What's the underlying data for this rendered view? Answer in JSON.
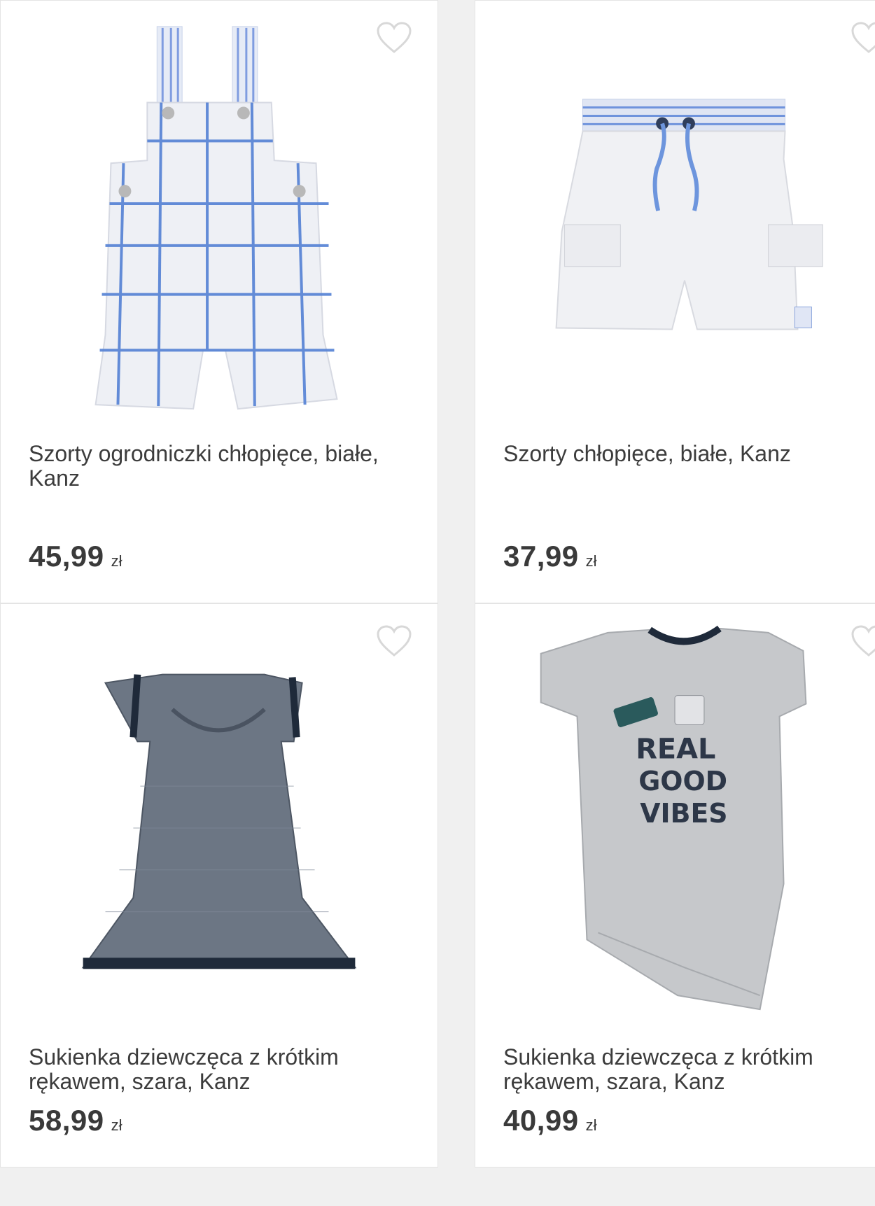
{
  "products": [
    {
      "title": "Szorty ogrodniczki chłopięce, białe, Kanz",
      "price": "45,99",
      "currency": "zł",
      "image": "overalls-shorts-icon"
    },
    {
      "title": "Szorty chłopięce, białe, Kanz",
      "price": "37,99",
      "currency": "zł",
      "image": "shorts-icon"
    },
    {
      "title": "Sukienka dziewczęca z krótkim rękawem, szara, Kanz",
      "price": "58,99",
      "currency": "zł",
      "image": "dress-icon"
    },
    {
      "title": "Sukienka dziewczęca z krótkim rękawem, szara, Kanz",
      "price": "40,99",
      "currency": "zł",
      "image": "tshirt-dress-icon"
    }
  ],
  "tshirt_print": {
    "line1": "REAL",
    "line2": "GOOD",
    "line3": "VIBES"
  },
  "colors": {
    "text": "#3c3c3c",
    "price": "#3a3a3a",
    "heart": "#d8d8d8",
    "check_blue": "#5b86d6"
  }
}
